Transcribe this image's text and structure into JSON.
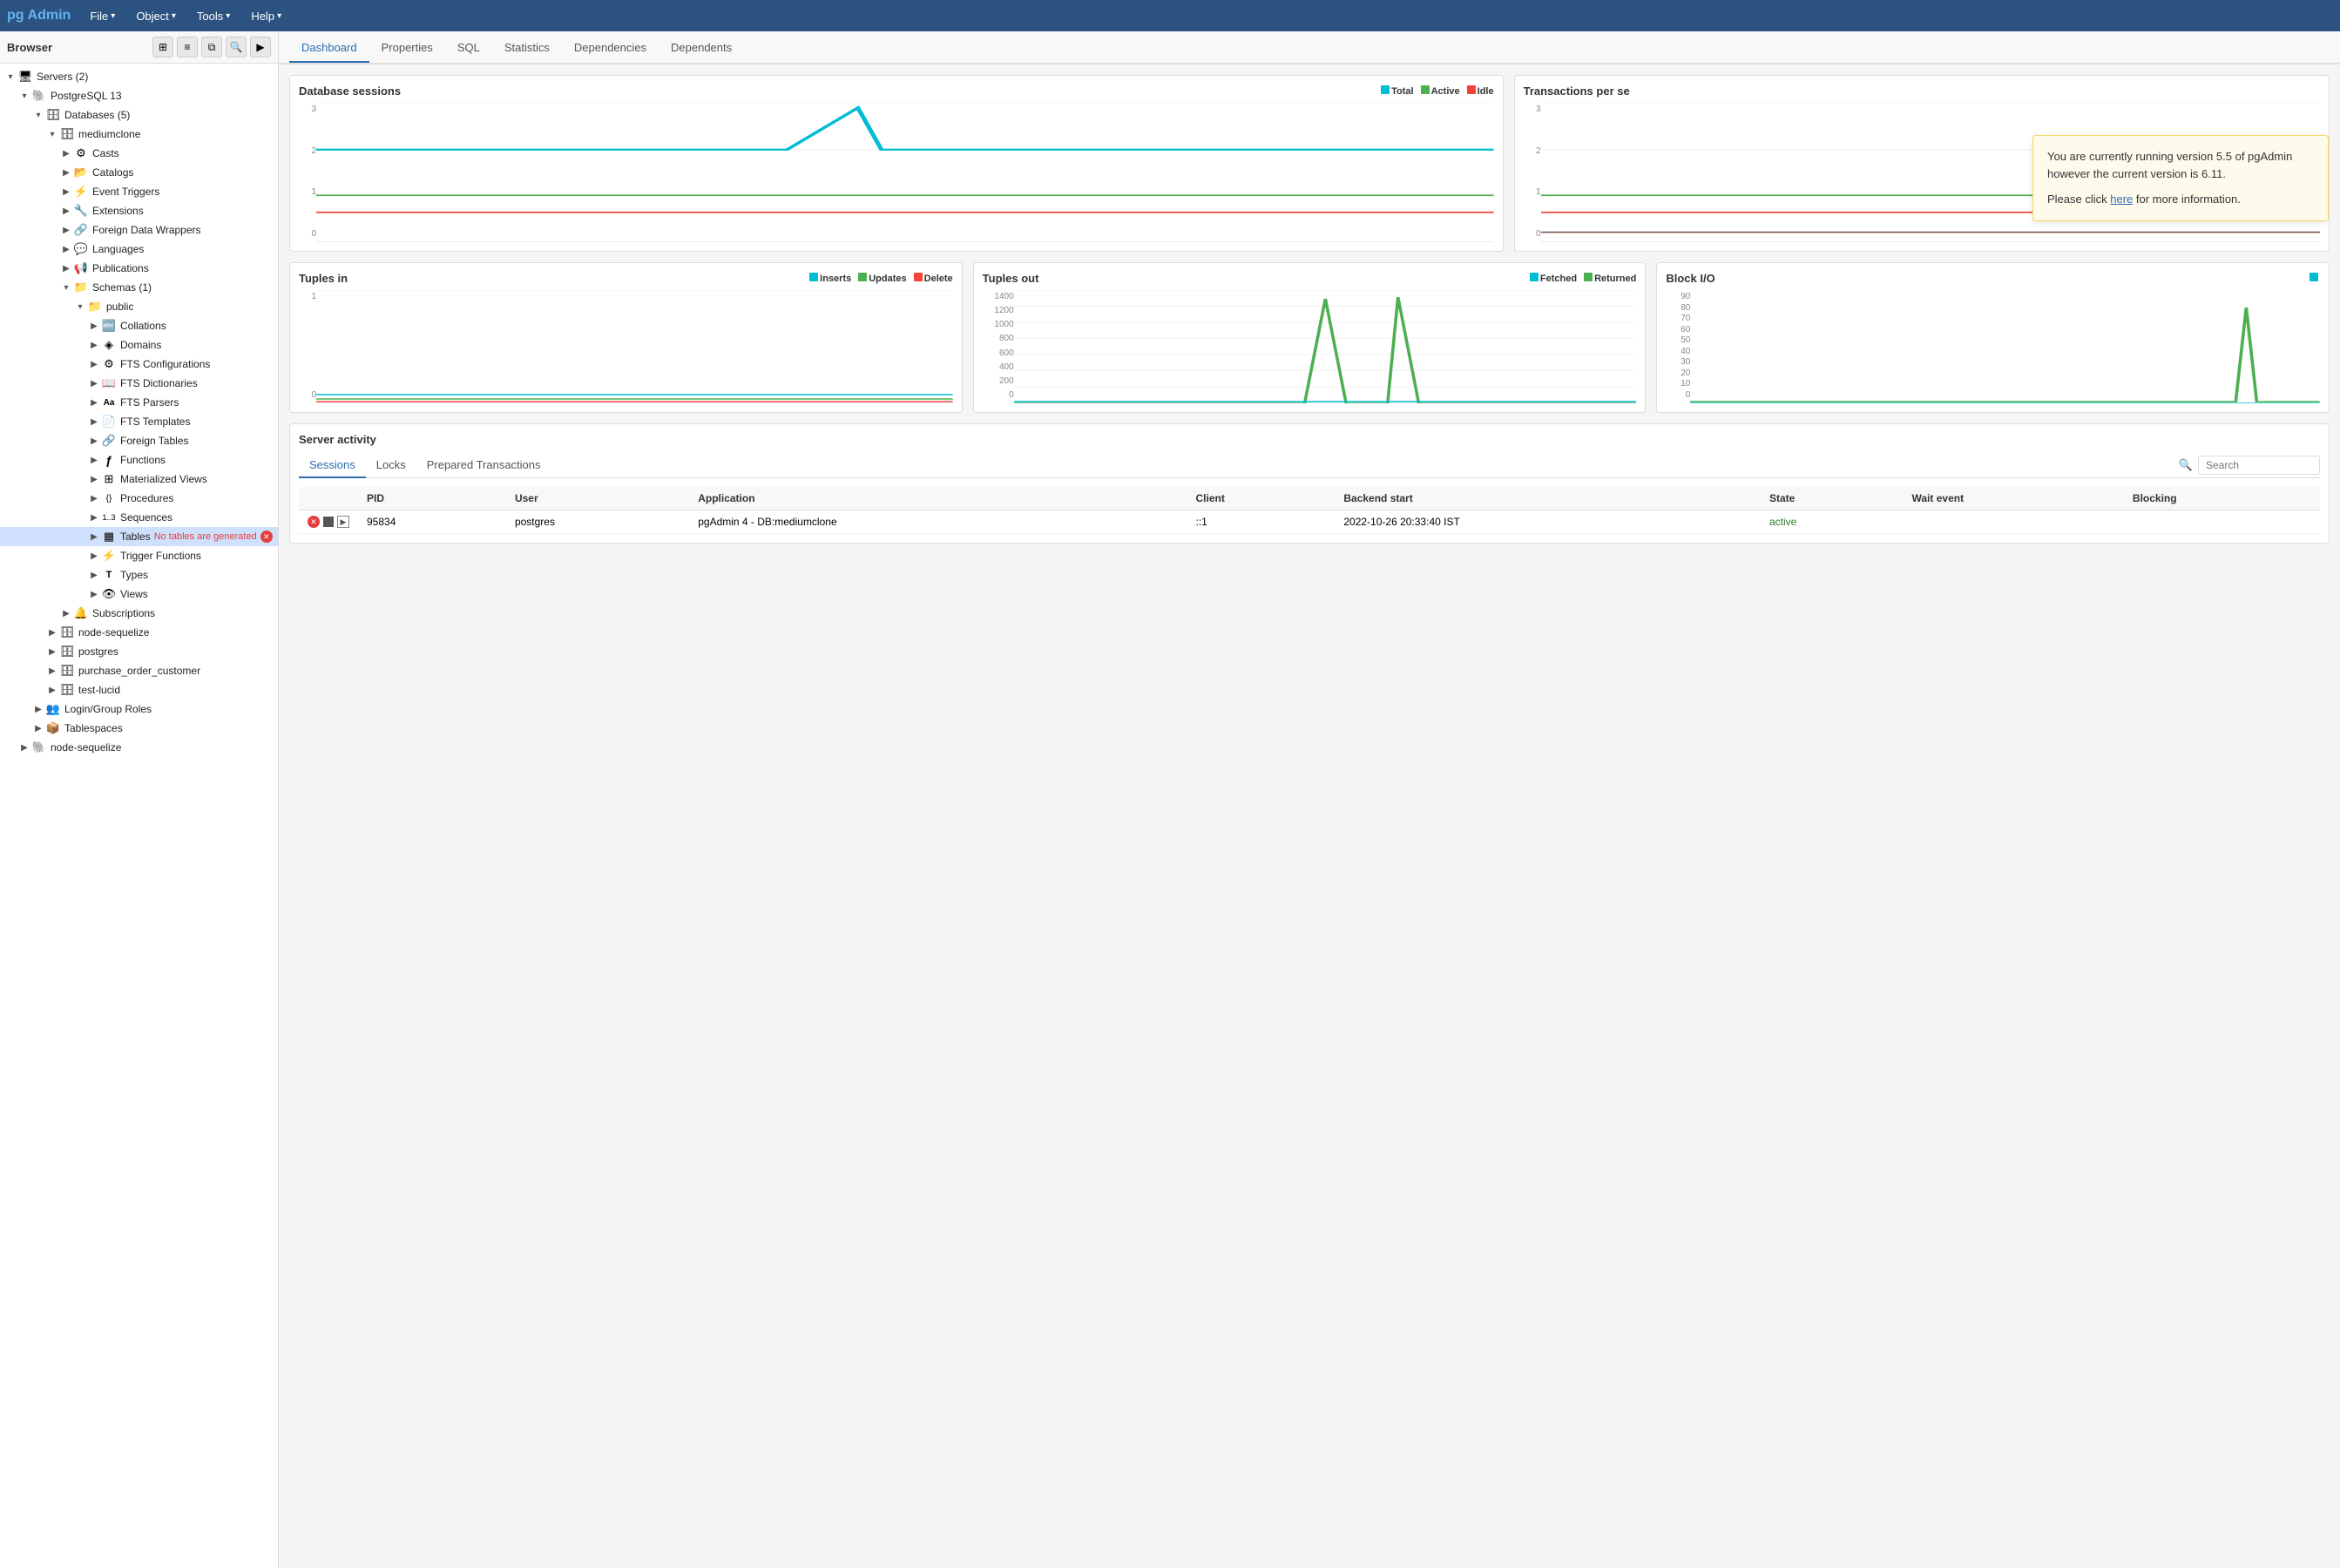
{
  "app": {
    "name": "pgAdmin",
    "logo": "pg",
    "logo_accent": "Admin"
  },
  "topbar": {
    "menus": [
      {
        "label": "File",
        "id": "file"
      },
      {
        "label": "Object",
        "id": "object"
      },
      {
        "label": "Tools",
        "id": "tools"
      },
      {
        "label": "Help",
        "id": "help"
      }
    ]
  },
  "sidebar": {
    "title": "Browser",
    "tree": [
      {
        "id": "servers",
        "label": "Servers (2)",
        "level": 0,
        "expanded": true,
        "icon": "🖥",
        "toggle": "▾"
      },
      {
        "id": "postgresql13",
        "label": "PostgreSQL 13",
        "level": 1,
        "expanded": true,
        "icon": "🐘",
        "toggle": "▾"
      },
      {
        "id": "databases",
        "label": "Databases (5)",
        "level": 2,
        "expanded": true,
        "icon": "🗄",
        "toggle": "▾"
      },
      {
        "id": "mediumclone",
        "label": "mediumclone",
        "level": 3,
        "expanded": true,
        "icon": "🗄",
        "toggle": "▾"
      },
      {
        "id": "casts",
        "label": "Casts",
        "level": 4,
        "expanded": false,
        "icon": "⚙",
        "toggle": "▶"
      },
      {
        "id": "catalogs",
        "label": "Catalogs",
        "level": 4,
        "expanded": false,
        "icon": "📂",
        "toggle": "▶"
      },
      {
        "id": "event-triggers",
        "label": "Event Triggers",
        "level": 4,
        "expanded": false,
        "icon": "⚡",
        "toggle": "▶"
      },
      {
        "id": "extensions",
        "label": "Extensions",
        "level": 4,
        "expanded": false,
        "icon": "🔧",
        "toggle": "▶"
      },
      {
        "id": "foreign-data-wrappers",
        "label": "Foreign Data Wrappers",
        "level": 4,
        "expanded": false,
        "icon": "🔗",
        "toggle": "▶"
      },
      {
        "id": "languages",
        "label": "Languages",
        "level": 4,
        "expanded": false,
        "icon": "💬",
        "toggle": "▶"
      },
      {
        "id": "publications",
        "label": "Publications",
        "level": 4,
        "expanded": false,
        "icon": "📢",
        "toggle": "▶"
      },
      {
        "id": "schemas",
        "label": "Schemas (1)",
        "level": 4,
        "expanded": true,
        "icon": "📁",
        "toggle": "▾"
      },
      {
        "id": "public",
        "label": "public",
        "level": 5,
        "expanded": true,
        "icon": "📁",
        "toggle": "▾"
      },
      {
        "id": "collations",
        "label": "Collations",
        "level": 6,
        "expanded": false,
        "icon": "🔤",
        "toggle": "▶"
      },
      {
        "id": "domains",
        "label": "Domains",
        "level": 6,
        "expanded": false,
        "icon": "◈",
        "toggle": "▶"
      },
      {
        "id": "fts-configurations",
        "label": "FTS Configurations",
        "level": 6,
        "expanded": false,
        "icon": "⚙",
        "toggle": "▶"
      },
      {
        "id": "fts-dictionaries",
        "label": "FTS Dictionaries",
        "level": 6,
        "expanded": false,
        "icon": "📖",
        "toggle": "▶"
      },
      {
        "id": "fts-parsers",
        "label": "FTS Parsers",
        "level": 6,
        "expanded": false,
        "icon": "Aa",
        "toggle": "▶"
      },
      {
        "id": "fts-templates",
        "label": "FTS Templates",
        "level": 6,
        "expanded": false,
        "icon": "📄",
        "toggle": "▶"
      },
      {
        "id": "foreign-tables",
        "label": "Foreign Tables",
        "level": 6,
        "expanded": false,
        "icon": "🔗",
        "toggle": "▶"
      },
      {
        "id": "functions",
        "label": "Functions",
        "level": 6,
        "expanded": false,
        "icon": "ƒ",
        "toggle": "▶"
      },
      {
        "id": "materialized-views",
        "label": "Materialized Views",
        "level": 6,
        "expanded": false,
        "icon": "⊞",
        "toggle": "▶"
      },
      {
        "id": "procedures",
        "label": "Procedures",
        "level": 6,
        "expanded": false,
        "icon": "{}",
        "toggle": "▶"
      },
      {
        "id": "sequences",
        "label": "Sequences",
        "level": 6,
        "expanded": false,
        "icon": "1..3",
        "toggle": "▶"
      },
      {
        "id": "tables",
        "label": "Tables",
        "level": 6,
        "expanded": true,
        "icon": "▦",
        "toggle": "▶",
        "selected": true,
        "no_tables_msg": "No tables are generated"
      },
      {
        "id": "trigger-functions",
        "label": "Trigger Functions",
        "level": 6,
        "expanded": false,
        "icon": "⚡",
        "toggle": "▶"
      },
      {
        "id": "types",
        "label": "Types",
        "level": 6,
        "expanded": false,
        "icon": "T",
        "toggle": "▶"
      },
      {
        "id": "views",
        "label": "Views",
        "level": 6,
        "expanded": false,
        "icon": "👁",
        "toggle": "▶"
      },
      {
        "id": "subscriptions",
        "label": "Subscriptions",
        "level": 4,
        "expanded": false,
        "icon": "🔔",
        "toggle": "▶"
      },
      {
        "id": "node-sequelize",
        "label": "node-sequelize",
        "level": 3,
        "expanded": false,
        "icon": "🗄",
        "toggle": "▶"
      },
      {
        "id": "postgres",
        "label": "postgres",
        "level": 3,
        "expanded": false,
        "icon": "🗄",
        "toggle": "▶"
      },
      {
        "id": "purchase-order-customer",
        "label": "purchase_order_customer",
        "level": 3,
        "expanded": false,
        "icon": "🗄",
        "toggle": "▶"
      },
      {
        "id": "test-lucid",
        "label": "test-lucid",
        "level": 3,
        "expanded": false,
        "icon": "🗄",
        "toggle": "▶"
      },
      {
        "id": "login-group-roles",
        "label": "Login/Group Roles",
        "level": 2,
        "expanded": false,
        "icon": "👥",
        "toggle": "▶"
      },
      {
        "id": "tablespaces",
        "label": "Tablespaces",
        "level": 2,
        "expanded": false,
        "icon": "📦",
        "toggle": "▶"
      },
      {
        "id": "node-sequelize2",
        "label": "node-sequelize",
        "level": 1,
        "expanded": false,
        "icon": "🐘",
        "toggle": "▶"
      }
    ]
  },
  "tabs": [
    {
      "label": "Dashboard",
      "active": true
    },
    {
      "label": "Properties"
    },
    {
      "label": "SQL"
    },
    {
      "label": "Statistics"
    },
    {
      "label": "Dependencies"
    },
    {
      "label": "Dependents"
    }
  ],
  "dashboard": {
    "db_sessions": {
      "title": "Database sessions",
      "legend": [
        {
          "label": "Total",
          "color": "#00bcd4"
        },
        {
          "label": "Active",
          "color": "#4caf50"
        },
        {
          "label": "Idle",
          "color": "#f44336"
        }
      ],
      "y_labels": [
        "3",
        "2",
        "1",
        "0"
      ],
      "data": {
        "total_line": "M0,60 L200,60 L250,60 L280,5 L290,60 L600,60",
        "active_line": "M0,90 L600,90",
        "idle_line": "M0,110 L600,110"
      }
    },
    "transactions_per_sec": {
      "title": "Transactions per se",
      "y_labels": [
        "3",
        "2",
        "1",
        "0"
      ]
    },
    "tuples_in": {
      "title": "Tuples in",
      "legend": [
        {
          "label": "Inserts",
          "color": "#00bcd4"
        },
        {
          "label": "Updates",
          "color": "#4caf50"
        },
        {
          "label": "Delete",
          "color": "#f44336"
        }
      ],
      "y_labels": [
        "1",
        "0"
      ]
    },
    "tuples_out": {
      "title": "Tuples out",
      "legend": [
        {
          "label": "Fetched",
          "color": "#00bcd4"
        },
        {
          "label": "Returned",
          "color": "#4caf50"
        }
      ],
      "y_labels": [
        "1400",
        "1200",
        "1000",
        "800",
        "600",
        "400",
        "200",
        "0"
      ]
    },
    "block_io": {
      "title": "Block I/O",
      "y_labels": [
        "90",
        "80",
        "70",
        "60",
        "50",
        "40",
        "30",
        "20",
        "10",
        "0"
      ]
    },
    "server_activity": {
      "title": "Server activity",
      "tabs": [
        {
          "label": "Sessions",
          "active": true
        },
        {
          "label": "Locks"
        },
        {
          "label": "Prepared Transactions"
        }
      ],
      "search_placeholder": "Search",
      "columns": [
        "PID",
        "User",
        "Application",
        "Client",
        "Backend start",
        "State",
        "Wait event",
        "Blocking"
      ],
      "rows": [
        {
          "pid": "95834",
          "user": "postgres",
          "application": "pgAdmin 4 - DB:mediumclone",
          "client": "::1",
          "backend_start": "2022-10-26 20:33:40 IST",
          "state": "active",
          "wait_event": "",
          "blocking": ""
        }
      ]
    }
  },
  "notification": {
    "text1": "You are currently running version 5.5 of pgAdmin however the current version is 6.11.",
    "text2": "Please click ",
    "link_text": "here",
    "text3": " for more information."
  }
}
